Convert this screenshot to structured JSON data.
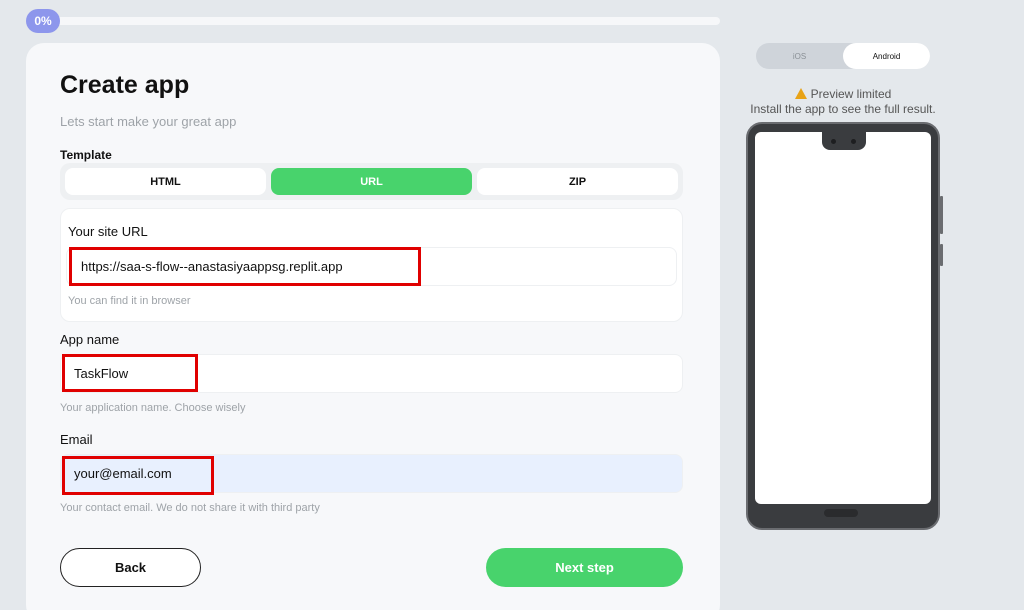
{
  "progress": {
    "percent_label": "0%",
    "value": 0
  },
  "form": {
    "title": "Create app",
    "subtitle": "Lets start make your great app",
    "template_label": "Template",
    "template_options": [
      "HTML",
      "URL",
      "ZIP"
    ],
    "template_selected": "URL",
    "site_url": {
      "label": "Your site URL",
      "value": "https://saa-s-flow--anastasiyaappsg.replit.app",
      "hint": "You can find it in browser"
    },
    "app_name": {
      "label": "App name",
      "value": "TaskFlow",
      "hint": "Your application name. Choose wisely"
    },
    "email": {
      "label": "Email",
      "value": "your@email.com",
      "hint": "Your contact email. We do not share it with third party"
    },
    "back_label": "Back",
    "next_label": "Next step"
  },
  "preview": {
    "os_options": [
      "iOS",
      "Android"
    ],
    "os_selected": "Android",
    "warning_icon": "warning-icon",
    "limited_text": "Preview limited",
    "install_text": "Install the app to see the full result."
  },
  "colors": {
    "accent_green": "#48d36c",
    "badge_purple": "#8d96ec",
    "highlight_red": "#e00000"
  }
}
